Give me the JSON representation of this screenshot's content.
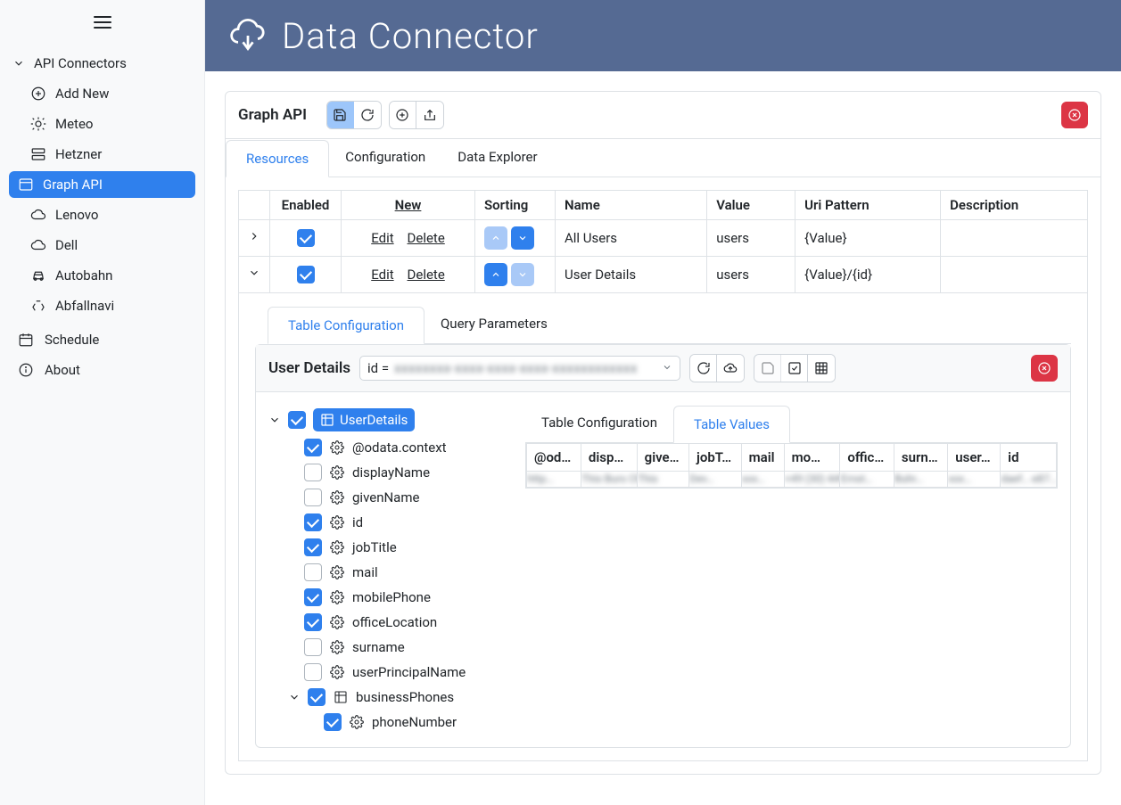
{
  "app": {
    "title": "Data Connector"
  },
  "sidebar": {
    "section": "API Connectors",
    "add_new": "Add New",
    "items": [
      "Meteo",
      "Hetzner",
      "Graph API",
      "Lenovo",
      "Dell",
      "Autobahn",
      "Abfallnavi"
    ],
    "schedule": "Schedule",
    "about": "About"
  },
  "panel": {
    "title": "Graph API"
  },
  "main_tabs": {
    "resources": "Resources",
    "configuration": "Configuration",
    "explorer": "Data Explorer"
  },
  "grid": {
    "headers": {
      "enabled": "Enabled",
      "new": "New",
      "sorting": "Sorting",
      "name": "Name",
      "value": "Value",
      "uri": "Uri Pattern",
      "desc": "Description"
    },
    "actions": {
      "edit": "Edit",
      "delete": "Delete"
    },
    "rows": [
      {
        "name": "All Users",
        "value": "users",
        "uri": "{Value}",
        "desc": ""
      },
      {
        "name": "User Details",
        "value": "users",
        "uri": "{Value}/{id}",
        "desc": ""
      }
    ]
  },
  "detail_tabs": {
    "config": "Table Configuration",
    "query": "Query Parameters"
  },
  "detail": {
    "title": "User Details",
    "id_label": "id =",
    "id_value": "xxxxxxxx-xxxx-xxxx-xxxx-xxxxxxxxxxxx"
  },
  "tree": {
    "root": "UserDetails",
    "fields": [
      {
        "name": "@odata.context",
        "checked": true
      },
      {
        "name": "displayName",
        "checked": false
      },
      {
        "name": "givenName",
        "checked": false
      },
      {
        "name": "id",
        "checked": true
      },
      {
        "name": "jobTitle",
        "checked": true
      },
      {
        "name": "mail",
        "checked": false
      },
      {
        "name": "mobilePhone",
        "checked": true
      },
      {
        "name": "officeLocation",
        "checked": true
      },
      {
        "name": "surname",
        "checked": false
      },
      {
        "name": "userPrincipalName",
        "checked": false
      }
    ],
    "subgroup": {
      "name": "businessPhones",
      "checked": true,
      "child": {
        "name": "phoneNumber",
        "checked": true
      }
    }
  },
  "right": {
    "tabs": {
      "config": "Table Configuration",
      "values": "Table Values"
    },
    "cols": [
      "@od…",
      "disp…",
      "give…",
      "jobT…",
      "mail",
      "mo…",
      "offic…",
      "surn…",
      "user…",
      "id"
    ],
    "row": [
      "http…",
      "This Burs CMO Adm…",
      "This",
      "Dev…",
      "xxx…",
      "+49 (30) 449…",
      "Ernst…",
      "Buhr…",
      "xxx…",
      "daef… e87… 446… 843… 79a…"
    ]
  }
}
